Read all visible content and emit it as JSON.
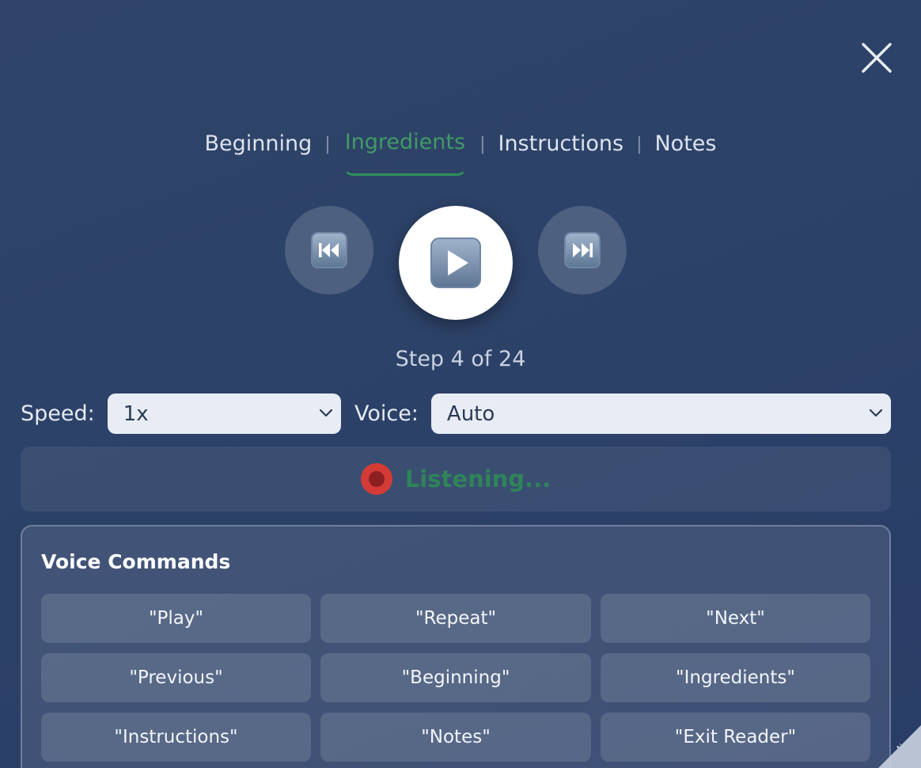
{
  "tabs": [
    {
      "label": "Beginning"
    },
    {
      "label": "Ingredients",
      "active": true
    },
    {
      "label": "Instructions"
    },
    {
      "label": "Notes"
    }
  ],
  "tab_separator": "|",
  "player": {
    "previous_icon": "previous-track-icon",
    "play_icon": "play-icon",
    "next_icon": "next-track-icon"
  },
  "step_text": "Step 4 of 24",
  "settings": {
    "speed_label": "Speed:",
    "speed_value": "1x",
    "voice_label": "Voice:",
    "voice_value": "Auto"
  },
  "status": {
    "text": "Listening..."
  },
  "voice_commands": {
    "title": "Voice Commands",
    "commands": [
      "\"Play\"",
      "\"Repeat\"",
      "\"Next\"",
      "\"Previous\"",
      "\"Beginning\"",
      "\"Ingredients\"",
      "\"Instructions\"",
      "\"Notes\"",
      "\"Exit Reader\""
    ]
  },
  "colors": {
    "background": "#2c4168",
    "active_tab": "#3f9a66",
    "listening": "#2f8458",
    "record": "#d53b36"
  }
}
